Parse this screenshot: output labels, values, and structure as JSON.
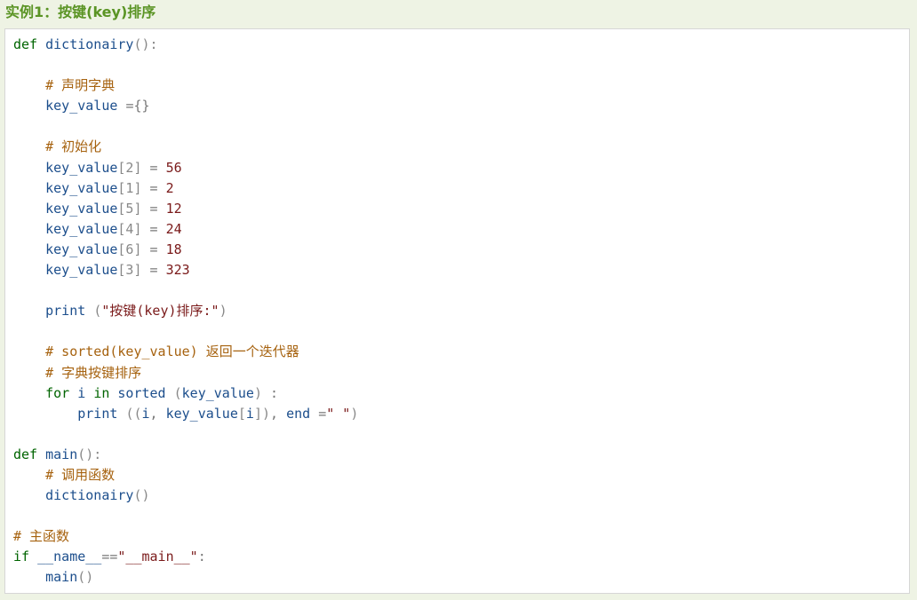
{
  "page": {
    "heading": "实例1：按键(key)排序"
  },
  "code": {
    "lines": [
      [
        [
          "kw",
          "def"
        ],
        [
          "pl",
          " "
        ],
        [
          "name",
          "dictionairy"
        ],
        [
          "br",
          "():"
        ]
      ],
      [],
      [
        [
          "pl",
          "    "
        ],
        [
          "cm",
          "# 声明字典"
        ]
      ],
      [
        [
          "pl",
          "    "
        ],
        [
          "name",
          "key_value"
        ],
        [
          "pl",
          " "
        ],
        [
          "op",
          "={}"
        ]
      ],
      [],
      [
        [
          "pl",
          "    "
        ],
        [
          "cm",
          "# 初始化"
        ]
      ],
      [
        [
          "pl",
          "    "
        ],
        [
          "name",
          "key_value"
        ],
        [
          "br",
          "[2]"
        ],
        [
          "pl",
          " "
        ],
        [
          "op",
          "="
        ],
        [
          "pl",
          " "
        ],
        [
          "num",
          "56"
        ]
      ],
      [
        [
          "pl",
          "    "
        ],
        [
          "name",
          "key_value"
        ],
        [
          "br",
          "[1]"
        ],
        [
          "pl",
          " "
        ],
        [
          "op",
          "="
        ],
        [
          "pl",
          " "
        ],
        [
          "num",
          "2"
        ]
      ],
      [
        [
          "pl",
          "    "
        ],
        [
          "name",
          "key_value"
        ],
        [
          "br",
          "[5]"
        ],
        [
          "pl",
          " "
        ],
        [
          "op",
          "="
        ],
        [
          "pl",
          " "
        ],
        [
          "num",
          "12"
        ]
      ],
      [
        [
          "pl",
          "    "
        ],
        [
          "name",
          "key_value"
        ],
        [
          "br",
          "[4]"
        ],
        [
          "pl",
          " "
        ],
        [
          "op",
          "="
        ],
        [
          "pl",
          " "
        ],
        [
          "num",
          "24"
        ]
      ],
      [
        [
          "pl",
          "    "
        ],
        [
          "name",
          "key_value"
        ],
        [
          "br",
          "[6]"
        ],
        [
          "pl",
          " "
        ],
        [
          "op",
          "="
        ],
        [
          "pl",
          " "
        ],
        [
          "num",
          "18"
        ]
      ],
      [
        [
          "pl",
          "    "
        ],
        [
          "name",
          "key_value"
        ],
        [
          "br",
          "[3]"
        ],
        [
          "pl",
          " "
        ],
        [
          "op",
          "="
        ],
        [
          "pl",
          " "
        ],
        [
          "num",
          "323"
        ]
      ],
      [],
      [
        [
          "pl",
          "    "
        ],
        [
          "name",
          "print"
        ],
        [
          "pl",
          " "
        ],
        [
          "br",
          "("
        ],
        [
          "str",
          "\"按键(key)排序:\""
        ],
        [
          "br",
          ")"
        ]
      ],
      [],
      [
        [
          "pl",
          "    "
        ],
        [
          "cm",
          "# sorted(key_value) 返回一个迭代器"
        ]
      ],
      [
        [
          "pl",
          "    "
        ],
        [
          "cm",
          "# 字典按键排序"
        ]
      ],
      [
        [
          "pl",
          "    "
        ],
        [
          "kw",
          "for"
        ],
        [
          "pl",
          " "
        ],
        [
          "name",
          "i"
        ],
        [
          "pl",
          " "
        ],
        [
          "kw",
          "in"
        ],
        [
          "pl",
          " "
        ],
        [
          "name",
          "sorted"
        ],
        [
          "pl",
          " "
        ],
        [
          "br",
          "("
        ],
        [
          "name",
          "key_value"
        ],
        [
          "br",
          ")"
        ],
        [
          "pl",
          " "
        ],
        [
          "op",
          ":"
        ]
      ],
      [
        [
          "pl",
          "        "
        ],
        [
          "name",
          "print"
        ],
        [
          "pl",
          " "
        ],
        [
          "br",
          "(("
        ],
        [
          "name",
          "i"
        ],
        [
          "op",
          ","
        ],
        [
          "pl",
          " "
        ],
        [
          "name",
          "key_value"
        ],
        [
          "br",
          "["
        ],
        [
          "name",
          "i"
        ],
        [
          "br",
          "])"
        ],
        [
          "op",
          ","
        ],
        [
          "pl",
          " "
        ],
        [
          "name",
          "end"
        ],
        [
          "pl",
          " "
        ],
        [
          "op",
          "="
        ],
        [
          "str",
          "\" \""
        ],
        [
          "br",
          ")"
        ]
      ],
      [],
      [
        [
          "kw",
          "def"
        ],
        [
          "pl",
          " "
        ],
        [
          "name",
          "main"
        ],
        [
          "br",
          "():"
        ]
      ],
      [
        [
          "pl",
          "    "
        ],
        [
          "cm",
          "# 调用函数"
        ]
      ],
      [
        [
          "pl",
          "    "
        ],
        [
          "name",
          "dictionairy"
        ],
        [
          "br",
          "()"
        ]
      ],
      [],
      [
        [
          "cm",
          "# 主函数"
        ]
      ],
      [
        [
          "kw",
          "if"
        ],
        [
          "pl",
          " "
        ],
        [
          "name",
          "__name__"
        ],
        [
          "op",
          "=="
        ],
        [
          "str",
          "\"__main__\""
        ],
        [
          "op",
          ":"
        ]
      ],
      [
        [
          "pl",
          "    "
        ],
        [
          "name",
          "main"
        ],
        [
          "br",
          "()"
        ]
      ]
    ]
  },
  "colors": {
    "page_background": "#eef3e4",
    "heading": "#5a9424",
    "keyword": "#006400",
    "identifier": "#1c4e8c",
    "number": "#7a1a1a",
    "string": "#7a1a1a",
    "comment": "#a6620f",
    "operator": "#777777"
  }
}
